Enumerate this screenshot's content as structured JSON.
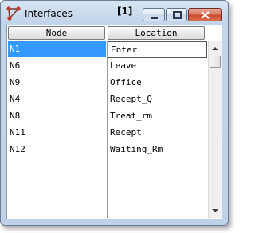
{
  "window": {
    "title": "Interfaces",
    "instance": "[1]"
  },
  "columns": {
    "node": "Node",
    "location": "Location"
  },
  "rows": [
    {
      "node": "N1",
      "location": "Enter"
    },
    {
      "node": "N6",
      "location": "Leave"
    },
    {
      "node": "N9",
      "location": "Office"
    },
    {
      "node": "N4",
      "location": "Recept_Q"
    },
    {
      "node": "N8",
      "location": "Treat_rm"
    },
    {
      "node": "N11",
      "location": "Recept"
    },
    {
      "node": "N12",
      "location": "Waiting_Rm"
    }
  ],
  "selection": {
    "row": 0
  },
  "colors": {
    "selection": "#3399ff",
    "close_button": "#c84a2c",
    "frame": "#c3d5ea"
  },
  "icons": [
    "network-icon",
    "minimize-icon",
    "maximize-icon",
    "close-icon",
    "scroll-up-arrow-icon",
    "scroll-down-arrow-icon"
  ]
}
